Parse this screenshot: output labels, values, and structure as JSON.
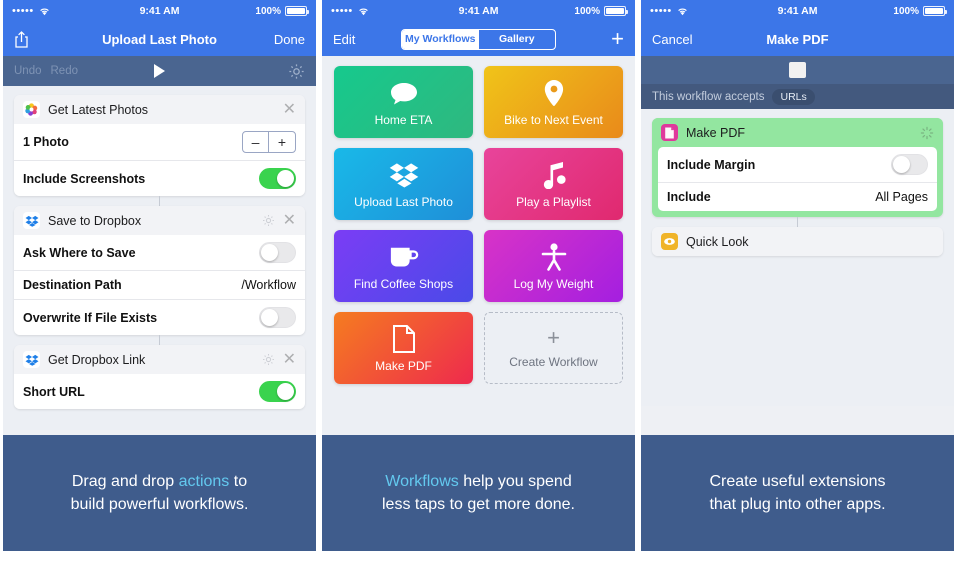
{
  "meta": {
    "accent_blue": "#3c76e8",
    "toolbar_blue": "#4a6590",
    "caption_blue": "#3f5c8c",
    "highlight_cyan": "#63c9ef",
    "toggle_green": "#3ad34e",
    "selected_green": "#93e6a0"
  },
  "statusbar": {
    "time": "9:41 AM",
    "battery": "100%",
    "signal_dots": "•••••"
  },
  "phone1": {
    "nav": {
      "share_icon": "share-icon",
      "title": "Upload Last Photo",
      "right_label": "Done"
    },
    "toolbar": {
      "undo": "Undo",
      "redo": "Redo",
      "play_icon": "play-icon",
      "settings_icon": "gear-icon"
    },
    "actions": [
      {
        "icon": "photos-icon",
        "title": "Get Latest Photos",
        "has_gear": false,
        "close_icon": "close-icon",
        "params": [
          {
            "label": "1 Photo",
            "control": "stepper",
            "minus": "–",
            "plus": "+"
          },
          {
            "label": "Include Screenshots",
            "control": "toggle",
            "on": true
          }
        ]
      },
      {
        "icon": "dropbox-icon",
        "title": "Save to Dropbox",
        "has_gear": true,
        "close_icon": "close-icon",
        "params": [
          {
            "label": "Ask Where to Save",
            "control": "toggle",
            "on": false
          },
          {
            "label": "Destination Path",
            "control": "value",
            "value": "/Workflow"
          },
          {
            "label": "Overwrite If File Exists",
            "control": "toggle",
            "on": false
          }
        ]
      },
      {
        "icon": "dropbox-icon",
        "title": "Get Dropbox Link",
        "has_gear": true,
        "close_icon": "close-icon",
        "params": [
          {
            "label": "Short URL",
            "control": "toggle",
            "on": true
          }
        ]
      }
    ],
    "caption": {
      "pre": "Drag and drop ",
      "highlight": "actions",
      "post": " to",
      "line2": "build powerful workflows."
    }
  },
  "phone2": {
    "nav": {
      "left_label": "Edit",
      "add_icon": "plus-icon"
    },
    "segments": [
      {
        "label": "My Workflows",
        "active": true
      },
      {
        "label": "Gallery",
        "active": false
      }
    ],
    "tiles": [
      {
        "label": "Home ETA",
        "icon": "speech-bubble-icon",
        "c1": "#16c98d",
        "c2": "#2fb87f"
      },
      {
        "label": "Bike to Next Event",
        "icon": "map-pin-icon",
        "c1": "#f0c419",
        "c2": "#e98a1a"
      },
      {
        "label": "Upload Last Photo",
        "icon": "dropbox-icon",
        "c1": "#19b9e8",
        "c2": "#1f8fd8"
      },
      {
        "label": "Play a Playlist",
        "icon": "music-note-icon",
        "c1": "#e8449b",
        "c2": "#e0296f"
      },
      {
        "label": "Find Coffee Shops",
        "icon": "coffee-cup-icon",
        "c1": "#7b3df5",
        "c2": "#4a4ae8"
      },
      {
        "label": "Log My Weight",
        "icon": "person-icon",
        "c1": "#d833c7",
        "c2": "#a41fe0"
      },
      {
        "label": "Make PDF",
        "icon": "document-icon",
        "c1": "#f57c20",
        "c2": "#ee2a4d"
      },
      {
        "label": "Create Workflow",
        "icon": "plus-icon",
        "create": true
      }
    ],
    "caption": {
      "highlight": "Workflows",
      "post": " help you spend",
      "line2": "less taps to get more done."
    }
  },
  "phone3": {
    "nav": {
      "left_label": "Cancel",
      "title": "Make PDF"
    },
    "extension_bar": {
      "thumb_icon": "document-thumbnail-icon"
    },
    "accepts": {
      "label": "This workflow accepts",
      "chip": "URLs"
    },
    "actions": [
      {
        "icon": "pdf-icon",
        "title": "Make PDF",
        "selected": true,
        "status_icon": "spinner-icon",
        "params": [
          {
            "label": "Include Margin",
            "control": "toggle",
            "on": false
          },
          {
            "label": "Include",
            "control": "value",
            "value": "All Pages"
          }
        ]
      },
      {
        "icon": "quicklook-icon",
        "title": "Quick Look",
        "selected": false,
        "params": []
      }
    ],
    "caption": {
      "line1": "Create useful extensions",
      "line2": "that plug into other apps."
    }
  }
}
